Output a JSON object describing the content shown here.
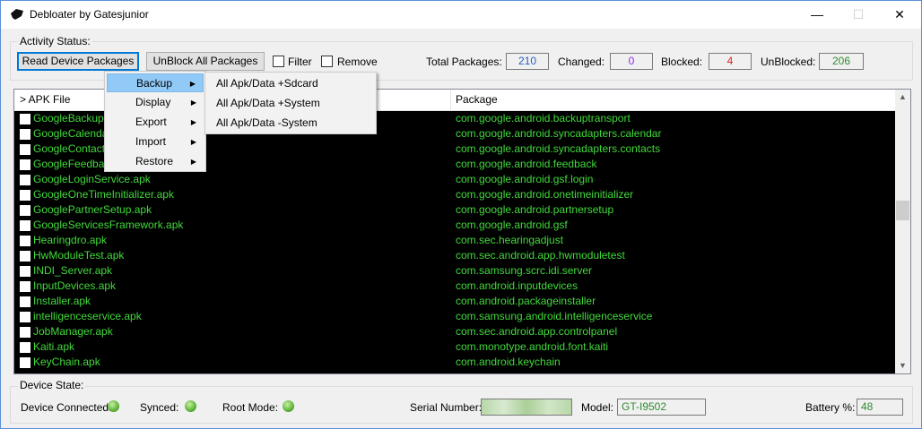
{
  "window": {
    "title": "Debloater by Gatesjunior",
    "min_glyph": "—",
    "max_glyph": "☐",
    "close_glyph": "✕"
  },
  "activity": {
    "group_label": "Activity Status:",
    "read_button": "Read Device Packages",
    "unblock_button": "UnBlock All Packages",
    "filter_label": "Filter",
    "remove_label": "Remove",
    "total_label": "Total Packages:",
    "total_value": "210",
    "changed_label": "Changed:",
    "changed_value": "0",
    "blocked_label": "Blocked:",
    "blocked_value": "4",
    "unblocked_label": "UnBlocked:",
    "unblocked_value": "206",
    "colors": {
      "total": "#1f5fbf",
      "changed": "#8a2be2",
      "blocked": "#e02020",
      "unblocked": "#2e8b2e"
    }
  },
  "list": {
    "col_apk": "> APK File",
    "col_package": "Package",
    "rows": [
      {
        "apk": "GoogleBackupTransport.apk",
        "package": "com.google.android.backuptransport"
      },
      {
        "apk": "GoogleCalendarSyncAdapter.apk",
        "package": "com.google.android.syncadapters.calendar"
      },
      {
        "apk": "GoogleContactsSyncAdapter.apk",
        "package": "com.google.android.syncadapters.contacts"
      },
      {
        "apk": "GoogleFeedback.apk",
        "package": "com.google.android.feedback"
      },
      {
        "apk": "GoogleLoginService.apk",
        "package": "com.google.android.gsf.login"
      },
      {
        "apk": "GoogleOneTimeInitializer.apk",
        "package": "com.google.android.onetimeinitializer"
      },
      {
        "apk": "GooglePartnerSetup.apk",
        "package": "com.google.android.partnersetup"
      },
      {
        "apk": "GoogleServicesFramework.apk",
        "package": "com.google.android.gsf"
      },
      {
        "apk": "Hearingdro.apk",
        "package": "com.sec.hearingadjust"
      },
      {
        "apk": "HwModuleTest.apk",
        "package": "com.sec.android.app.hwmoduletest"
      },
      {
        "apk": "INDI_Server.apk",
        "package": "com.samsung.scrc.idi.server"
      },
      {
        "apk": "InputDevices.apk",
        "package": "com.android.inputdevices"
      },
      {
        "apk": "Installer.apk",
        "package": "com.android.packageinstaller"
      },
      {
        "apk": "intelligenceservice.apk",
        "package": "com.samsung.android.intelligenceservice"
      },
      {
        "apk": "JobManager.apk",
        "package": "com.sec.android.app.controlpanel"
      },
      {
        "apk": "Kaiti.apk",
        "package": "com.monotype.android.font.kaiti"
      },
      {
        "apk": "KeyChain.apk",
        "package": "com.android.keychain"
      }
    ],
    "scroll_up": "▲",
    "scroll_down": "▼"
  },
  "context_menu": {
    "items": [
      "Backup",
      "Display",
      "Export",
      "Import",
      "Restore"
    ],
    "arrow": "▶",
    "submenu": [
      "All Apk/Data +Sdcard",
      "All Apk/Data +System",
      "All Apk/Data -System"
    ]
  },
  "device": {
    "group_label": "Device State:",
    "connected_label": "Device Connected:",
    "synced_label": "Synced:",
    "root_label": "Root Mode:",
    "serial_label": "Serial Number:",
    "model_label": "Model:",
    "model_value": "GT-I9502",
    "battery_label": "Battery %:",
    "battery_value": "48",
    "value_color": "#2e8b2e"
  }
}
